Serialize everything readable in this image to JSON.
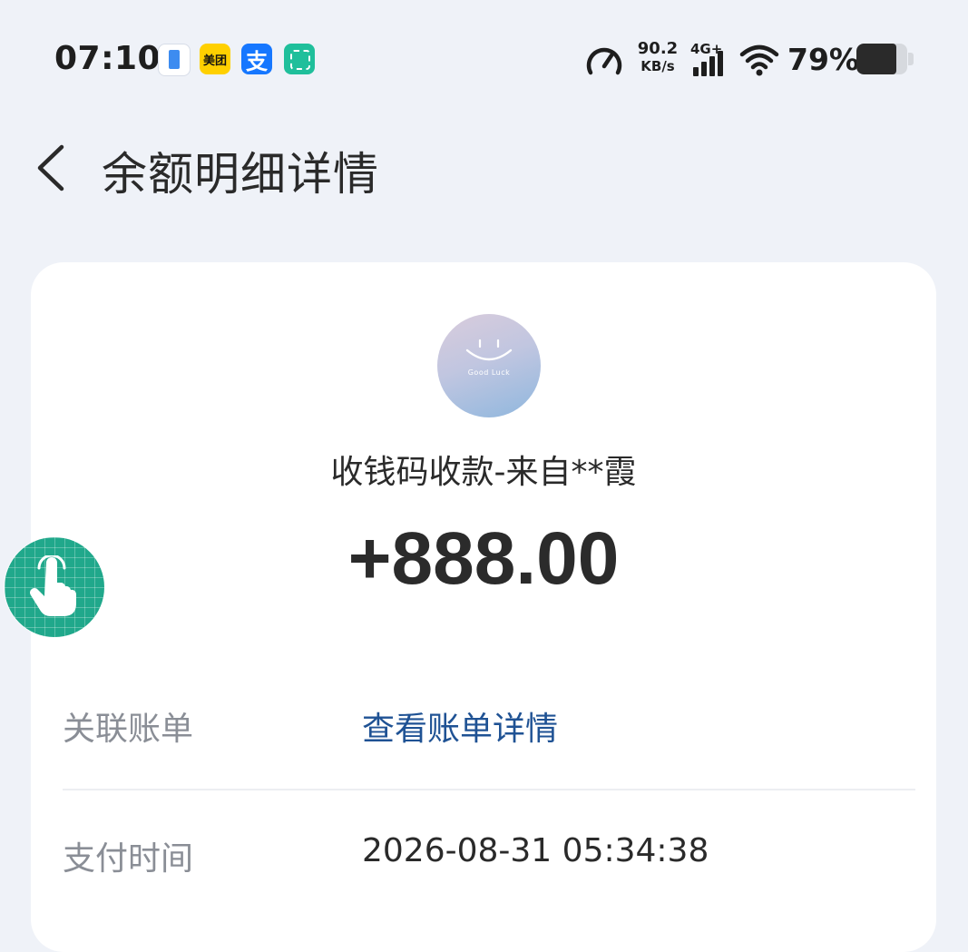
{
  "status_bar": {
    "time": "07:10",
    "notification_icons": [
      "phone-app-icon",
      "meituan-icon",
      "alipay-icon",
      "scan-app-icon"
    ],
    "meituan_label": "美团",
    "alipay_label": "支",
    "net_speed_value": "90.2",
    "net_speed_unit": "KB/s",
    "network_type": "4G+",
    "battery_percent": "79%",
    "battery_level": 0.79
  },
  "header": {
    "title": "余额明细详情",
    "back_icon": "chevron-left-icon"
  },
  "transaction": {
    "avatar_caption": "Good Luck",
    "title": "收钱码收款-来自**霞",
    "amount": "+888.00",
    "rows": [
      {
        "label": "关联账单",
        "value": "查看账单详情",
        "is_link": true
      },
      {
        "label": "支付时间",
        "value": "2026-08-31 05:34:38",
        "is_link": false
      }
    ]
  },
  "floating_button": {
    "icon": "tap-hand-icon"
  },
  "colors": {
    "background": "#eff2f8",
    "card": "#ffffff",
    "link": "#1f5294",
    "floating_button": "#20a88b"
  }
}
